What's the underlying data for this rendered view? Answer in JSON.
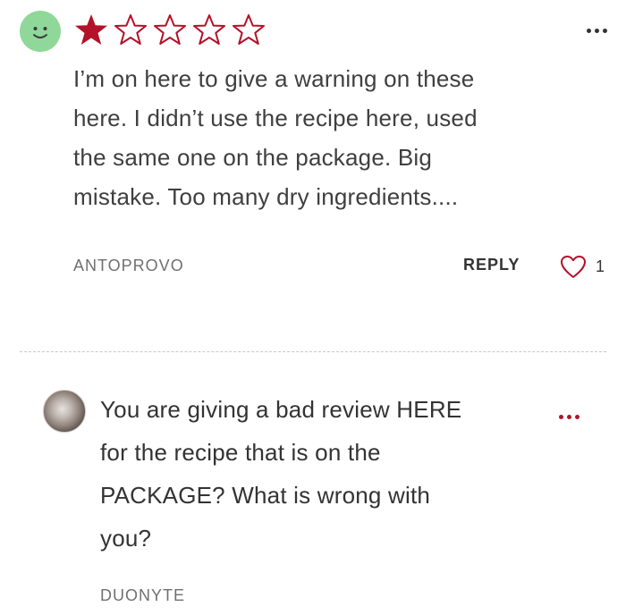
{
  "review": {
    "rating": 1,
    "max_rating": 5,
    "colors": {
      "star": "#b3122a",
      "avatar_bg": "#8fd89a",
      "heart": "#b3122a"
    },
    "icons": {
      "avatar": "smile-face-icon",
      "filled_star": "filled-star-icon",
      "empty_star": "outline-star-icon",
      "more": "more-dots-icon",
      "like": "heart-outline-icon"
    },
    "text_lines": [
      "I’m on here to give a warning on these",
      "here. I didn’t use the recipe here, used",
      "the same one on the package. Big",
      "mistake. Too many dry ingredients...."
    ],
    "author": "ANTOPROVO",
    "reply_label": "REPLY",
    "like_count": "1"
  },
  "reply": {
    "icons": {
      "avatar": "user-avatar-photo",
      "more": "more-dots-icon"
    },
    "text_lines": [
      "You are giving a bad review HERE",
      "for the recipe that is on the",
      "PACKAGE? What is wrong with",
      "you?"
    ],
    "author": "DUONYTE"
  }
}
